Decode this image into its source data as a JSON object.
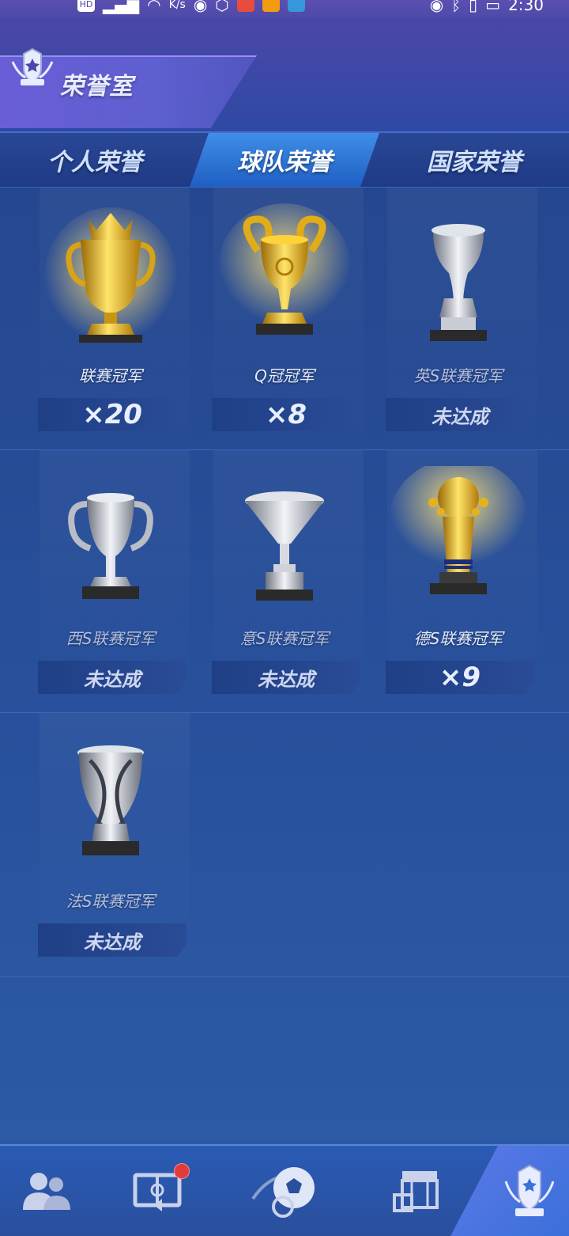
{
  "status_bar": {
    "hd": "HD",
    "speed": "K/s",
    "time": "2:30"
  },
  "header": {
    "title": "荣誉室",
    "logo_text": "TROPHY"
  },
  "tabs": [
    {
      "label": "个人荣誉",
      "active": false
    },
    {
      "label": "球队荣誉",
      "active": true
    },
    {
      "label": "国家荣誉",
      "active": false
    }
  ],
  "trophies": [
    {
      "name": "联赛冠军",
      "status": "×20",
      "achieved": true,
      "material": "gold"
    },
    {
      "name": "Q冠冠军",
      "status": "×8",
      "achieved": true,
      "material": "gold"
    },
    {
      "name": "英S联赛冠军",
      "status": "未达成",
      "achieved": false,
      "material": "silver"
    },
    {
      "name": "西S联赛冠军",
      "status": "未达成",
      "achieved": false,
      "material": "silver"
    },
    {
      "name": "意S联赛冠军",
      "status": "未达成",
      "achieved": false,
      "material": "silver"
    },
    {
      "name": "德S联赛冠军",
      "status": "×9",
      "achieved": true,
      "material": "gold"
    },
    {
      "name": "法S联赛冠军",
      "status": "未达成",
      "achieved": false,
      "material": "silver"
    }
  ],
  "bottom_nav": [
    {
      "icon": "friends-icon"
    },
    {
      "icon": "pitch-icon",
      "badge": true
    },
    {
      "icon": "soccer-ball-icon"
    },
    {
      "icon": "stadium-icon"
    },
    {
      "icon": "trophy-emblem-icon",
      "active": true
    }
  ],
  "colors": {
    "gold": "#f2c12e",
    "silver": "#cfd3da",
    "accent": "#3f8ee6"
  }
}
